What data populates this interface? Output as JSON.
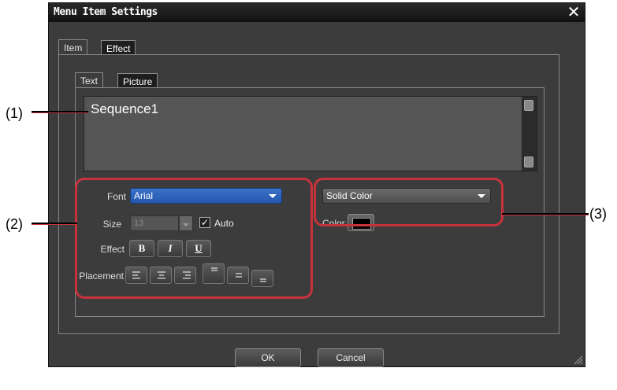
{
  "window": {
    "title": "Menu Item Settings",
    "close_glyph": "✕"
  },
  "tabs_outer": [
    {
      "label": "Item"
    },
    {
      "label": "Effect"
    }
  ],
  "tabs_inner": [
    {
      "label": "Text"
    },
    {
      "label": "Picture"
    }
  ],
  "text_field": {
    "value": "Sequence1"
  },
  "font_settings": {
    "font_label": "Font",
    "font_value": "Arial",
    "size_label": "Size",
    "size_value": "13",
    "auto_label": "Auto",
    "auto_checked": true,
    "check_glyph": "✓",
    "effect_label": "Effect",
    "effect_buttons": [
      {
        "label": "B"
      },
      {
        "label": "I"
      },
      {
        "label": "U"
      }
    ],
    "placement_label": "Placement"
  },
  "fill_settings": {
    "fill_type": "Solid Color",
    "color_label": "Color",
    "color_value": "#000000"
  },
  "footer": {
    "ok_label": "OK",
    "cancel_label": "Cancel"
  },
  "callouts": [
    {
      "label": "(1)"
    },
    {
      "label": "(2)"
    },
    {
      "label": "(3)"
    }
  ],
  "colors": {
    "highlight": "#c8323c",
    "dialog_bg": "#3c3c3c",
    "accent_dropdown": "#2f66c0"
  }
}
